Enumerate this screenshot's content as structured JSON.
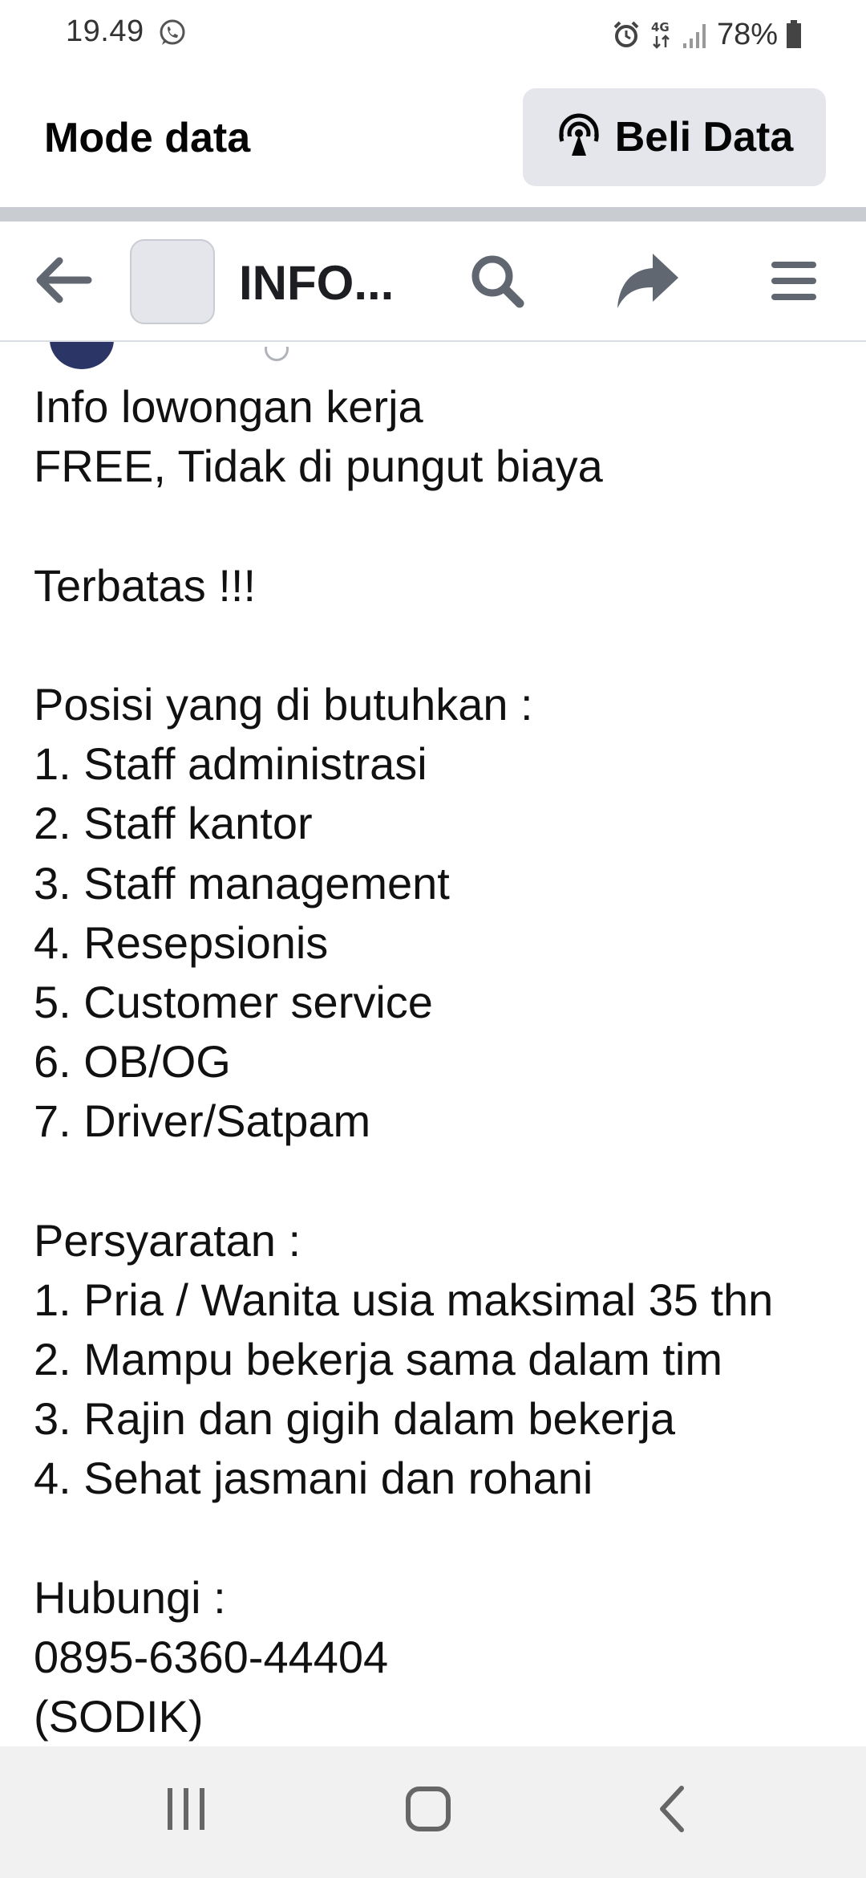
{
  "status_bar": {
    "time": "19.49",
    "network": "4G",
    "battery": "78%"
  },
  "data_bar": {
    "title": "Mode data",
    "buy_button_label": "Beli Data"
  },
  "toolbar": {
    "page_title": "INFO..."
  },
  "post": {
    "lines": [
      "Info lowongan kerja",
      "FREE, Tidak di pungut biaya",
      "",
      "Terbatas !!!",
      "",
      "Posisi yang di butuhkan :",
      "1. Staff administrasi",
      "2. Staff kantor",
      "3. Staff management",
      "4. Resepsionis",
      "5. Customer service",
      "6. OB/OG",
      "7. Driver/Satpam",
      "",
      "Persyaratan :",
      "1. Pria / Wanita usia maksimal 35 thn",
      "2. Mampu bekerja sama dalam tim",
      "3. Rajin dan gigih dalam bekerja",
      "4. Sehat jasmani dan rohani",
      "",
      "Hubungi  :",
      "0895-6360-44404",
      "(SODIK)"
    ]
  },
  "icons": {
    "status": [
      "whatsapp-icon",
      "alarm-icon",
      "network-4g-icon",
      "signal-icon",
      "battery-icon"
    ],
    "buy_data": "broadcast-icon",
    "toolbar": [
      "back-arrow-icon",
      "search-icon",
      "share-icon",
      "menu-icon"
    ],
    "nav": [
      "recent-apps-icon",
      "home-icon",
      "back-icon"
    ]
  },
  "colors": {
    "button_bg": "#e4e6eb",
    "divider": "#c9ccd1",
    "nav_bar_bg": "#f1f1f1",
    "text": "#111111"
  }
}
